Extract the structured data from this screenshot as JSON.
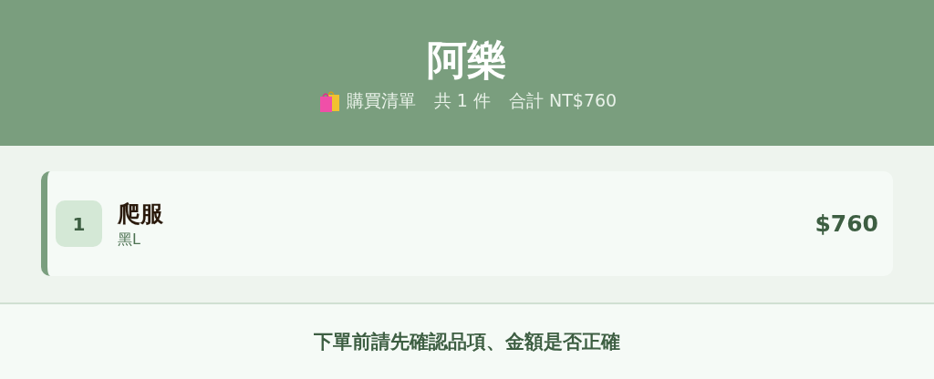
{
  "header": {
    "title": "阿樂",
    "subtitle": {
      "label": "購買清單",
      "count": "共 1 件",
      "total": "合計 NT$760"
    }
  },
  "items": [
    {
      "index": "1",
      "name": "爬服",
      "variant": "黑L",
      "price": "$760"
    }
  ],
  "footer": {
    "notice": "下單前請先確認品項、金額是否正確"
  }
}
